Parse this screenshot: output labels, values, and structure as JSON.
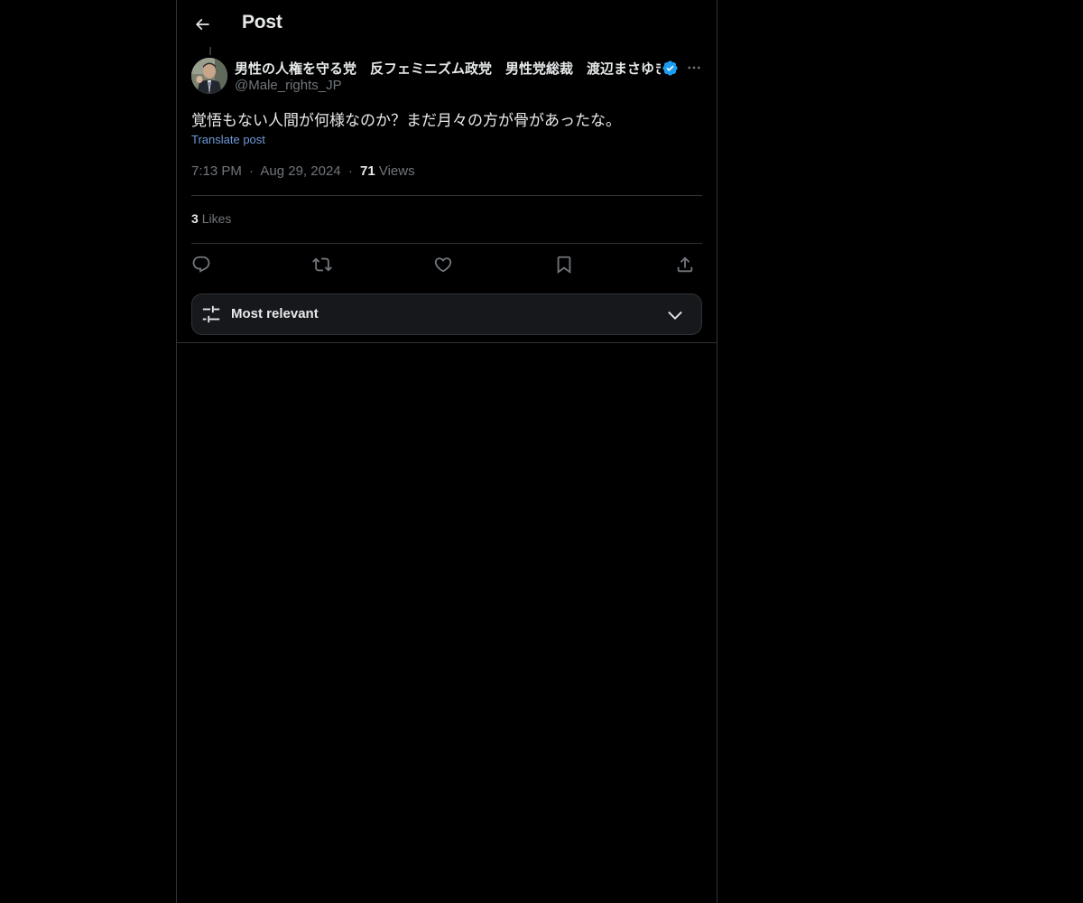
{
  "header": {
    "title": "Post",
    "back_icon": "arrow-left-icon"
  },
  "post": {
    "display_name": "男性の人権を守る党　反フェミニズム政党　男性党総裁　渡辺まさゆき",
    "handle": "@Male_rights_JP",
    "verified": true,
    "text": "覚悟もない人間が何様なのか？まだ月々の方が骨があったな。",
    "translate_label": "Translate post",
    "time": "7:13 PM",
    "date": "Aug 29, 2024",
    "separator": "·",
    "views_count": "71",
    "views_label": "Views",
    "likes_count": "3",
    "likes_label": "Likes"
  },
  "actions": [
    {
      "name": "reply-icon"
    },
    {
      "name": "repost-icon"
    },
    {
      "name": "like-icon"
    },
    {
      "name": "bookmark-icon"
    },
    {
      "name": "share-icon"
    }
  ],
  "sort": {
    "label": "Most relevant",
    "icon": "sliders-icon",
    "chevron": "chevron-down-icon"
  },
  "colors": {
    "background": "#000000",
    "text": "#e7e9ea",
    "muted": "#71767b",
    "border": "#2f3336",
    "link": "#6e99d8",
    "verified": "#1d9bf0"
  }
}
